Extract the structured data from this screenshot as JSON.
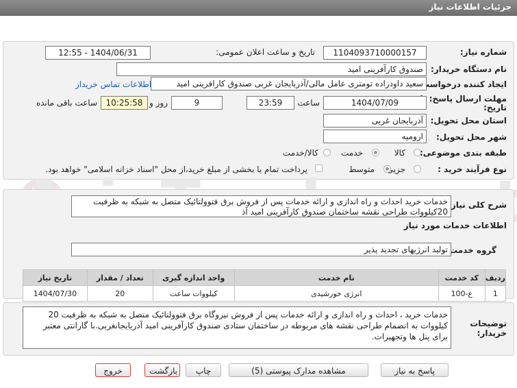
{
  "header": {
    "title": "جزئیات اطلاعات نیاز"
  },
  "watermark": {
    "text": "AriaTender.net"
  },
  "form": {
    "need_number_label": "شماره نیاز:",
    "need_number": "1104093710000157",
    "announce_label": "تاریخ و ساعت اعلان عمومی:",
    "announce_value": "1404/06/31 - 12:55",
    "buyer_org_label": "نام دستگاه خریدار:",
    "buyer_org": "صندوق کارآفرینی امید",
    "creator_label": "ایجاد کننده درخواست:",
    "creator": "سعید داودزاده تومتری عامل مالی/آذربایجان غربی صندوق کارافرینی امید",
    "contact_link": "اطلاعات تماس خریدار",
    "deadline_label_1": "مهلت ارسال پاسخ: تا",
    "deadline_label_2": "تاریخ:",
    "deadline_date": "1404/07/09",
    "time_label": "ساعت",
    "deadline_time": "23:59",
    "days_value": "9",
    "days_label": "روز و",
    "remaining_time": "10:25:58",
    "remaining_label": "ساعت باقی مانده",
    "province_label": "استان محل تحویل:",
    "province": "آذربایجان غربی",
    "city_label": "شهر محل تحویل:",
    "city": "ارومیه",
    "category_label": "طبقه بندی موضوعی:",
    "category_options": [
      "کالا",
      "خدمت",
      "کالا/خدمت"
    ],
    "category_selected": "خدمت",
    "process_label": "نوع فرآیند خرید :",
    "process_options": [
      "جزیی",
      "متوسط"
    ],
    "process_selected": "متوسط",
    "payment_note": "پرداخت تمام یا بخشی از مبلغ خرید،از محل \"اسناد خزانه اسلامی\" خواهد بود."
  },
  "summary": {
    "label": "شرح کلی نیاز:",
    "text": "خدمات خرید احداث و راه اندازی و ارائه خدمات پس از فروش برق فتوولتائیک متصل به شبکه به ظرفیت 20کیلووات طراحی نقشه  ساختمان صندوق کارآفرینی امید آذ"
  },
  "services": {
    "section_title": "اطلاعات خدمات مورد نیاز",
    "group_label": "گروه خدمت:",
    "group_value": "تولید انرژیهای تجدید پذیر",
    "columns": [
      "ردیف",
      "کد خدمت",
      "نام خدمت",
      "واحد اندازه گیری",
      "تعداد / مقدار",
      "تاریخ نیاز"
    ],
    "rows": [
      {
        "index": "1",
        "code": "غ-100",
        "name": "انرژی خورشیدی",
        "unit": "کیلووات ساعت",
        "qty": "20",
        "date": "1404/07/30"
      }
    ]
  },
  "buyer_notes": {
    "label_1": "توضیحات",
    "label_2": "خریدار:",
    "text": "خدمات خرید ، احداث و راه اندازی و ارائه خدمات پس از فروش نیروگاه برق فتوولتائیک متصل به شبکه به ظرفیت 20   کیلووات به انضمام طراحی نقشه های مربوطه در ساختمان ستادی صندوق کارآفرینی امید آذربایجانغربی.با گارانتی معتبر برای پنل ها وتجهیزات."
  },
  "buttons": {
    "reply": "پاسخ به نیاز",
    "attachments": "مشاهده مدارک پیوستی (5)",
    "print": "چاپ",
    "back": "بازگشت",
    "exit": "خروج"
  }
}
